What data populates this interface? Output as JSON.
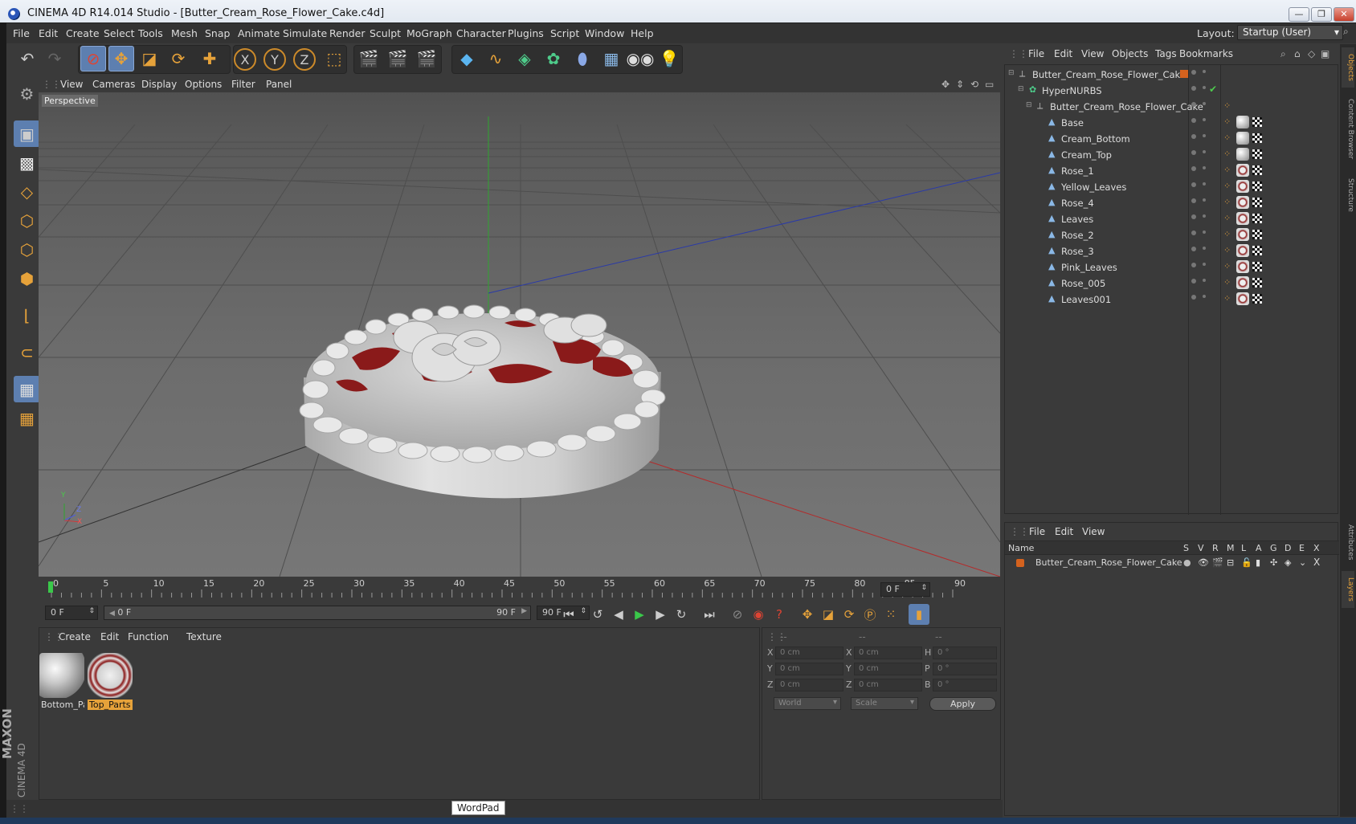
{
  "window": {
    "title": "CINEMA 4D R14.014 Studio - [Butter_Cream_Rose_Flower_Cake.c4d]",
    "minimize": "—",
    "restore": "❐",
    "close": "✕"
  },
  "menubar": {
    "items": [
      "File",
      "Edit",
      "Create",
      "Select",
      "Tools",
      "Mesh",
      "Snap",
      "Animate",
      "Simulate",
      "Render",
      "Sculpt",
      "MoGraph",
      "Character",
      "Plugins",
      "Script",
      "Window",
      "Help"
    ],
    "layout_label": "Layout:",
    "layout_value": "Startup (User)"
  },
  "toolbar": {
    "icons": [
      "undo-icon",
      "redo-icon",
      "live-selection-icon",
      "move-icon",
      "scale-icon",
      "rotate-icon",
      "add-icon",
      "x-axis-icon",
      "y-axis-icon",
      "z-axis-icon",
      "coordinate-system-icon",
      "render-view-icon",
      "render-picture-viewer-icon",
      "edit-render-settings-icon",
      "cube-primitive-icon",
      "spline-icon",
      "nurbs-icon",
      "array-icon",
      "deformer-icon",
      "floor-icon",
      "camera-icon",
      "light-icon"
    ],
    "axis_x": "X",
    "axis_y": "Y",
    "axis_z": "Z"
  },
  "viewport": {
    "menu": [
      "View",
      "Cameras",
      "Display",
      "Options",
      "Filter",
      "Panel"
    ],
    "camera_label": "Perspective",
    "axis_y": "Y",
    "axis_z": "Z",
    "axis_x": "X"
  },
  "timeline": {
    "ticks": [
      "0",
      "5",
      "10",
      "15",
      "20",
      "25",
      "30",
      "35",
      "40",
      "45",
      "50",
      "55",
      "60",
      "65",
      "70",
      "75",
      "80",
      "85",
      "90"
    ],
    "current_frame": "0 F",
    "start_frame": "0 F",
    "range_start": "0 F",
    "range_end": "90 F",
    "end_frame": "90 F",
    "max_frame": "0 F"
  },
  "materials": {
    "menu": [
      "Create",
      "Edit",
      "Function",
      "Texture"
    ],
    "items": [
      {
        "name": "Bottom_Pa",
        "selected": false
      },
      {
        "name": "Top_Parts",
        "selected": true
      }
    ]
  },
  "coordinates": {
    "headers": [
      "--",
      "--",
      "--"
    ],
    "rows": [
      {
        "l1": "X",
        "v1": "0 cm",
        "l2": "X",
        "v2": "0 cm",
        "l3": "H",
        "v3": "0 °"
      },
      {
        "l1": "Y",
        "v1": "0 cm",
        "l2": "Y",
        "v2": "0 cm",
        "l3": "P",
        "v3": "0 °"
      },
      {
        "l1": "Z",
        "v1": "0 cm",
        "l2": "Z",
        "v2": "0 cm",
        "l3": "B",
        "v3": "0 °"
      }
    ],
    "space": "World",
    "mode": "Scale",
    "apply": "Apply"
  },
  "object_manager": {
    "menu": [
      "File",
      "Edit",
      "View",
      "Objects",
      "Tags",
      "Bookmarks"
    ],
    "objects": [
      {
        "name": "Butter_Cream_Rose_Flower_Cake",
        "level": 0,
        "type": "null"
      },
      {
        "name": "HyperNURBS",
        "level": 1,
        "type": "hypernurbs"
      },
      {
        "name": "Butter_Cream_Rose_Flower_Cake",
        "level": 2,
        "type": "null"
      },
      {
        "name": "Base",
        "level": 3,
        "type": "poly",
        "mat": "white"
      },
      {
        "name": "Cream_Bottom",
        "level": 3,
        "type": "poly",
        "mat": "white"
      },
      {
        "name": "Cream_Top",
        "level": 3,
        "type": "poly",
        "mat": "white"
      },
      {
        "name": "Rose_1",
        "level": 3,
        "type": "poly",
        "mat": "red"
      },
      {
        "name": "Yellow_Leaves",
        "level": 3,
        "type": "poly",
        "mat": "red"
      },
      {
        "name": "Rose_4",
        "level": 3,
        "type": "poly",
        "mat": "red"
      },
      {
        "name": "Leaves",
        "level": 3,
        "type": "poly",
        "mat": "red"
      },
      {
        "name": "Rose_2",
        "level": 3,
        "type": "poly",
        "mat": "red"
      },
      {
        "name": "Rose_3",
        "level": 3,
        "type": "poly",
        "mat": "red"
      },
      {
        "name": "Pink_Leaves",
        "level": 3,
        "type": "poly",
        "mat": "red"
      },
      {
        "name": "Rose_005",
        "level": 3,
        "type": "poly",
        "mat": "red"
      },
      {
        "name": "Leaves001",
        "level": 3,
        "type": "poly",
        "mat": "red"
      }
    ]
  },
  "layer_manager": {
    "menu": [
      "File",
      "Edit",
      "View"
    ],
    "columns": [
      "Name",
      "S",
      "V",
      "R",
      "M",
      "L",
      "A",
      "G",
      "D",
      "E",
      "X"
    ],
    "layers": [
      {
        "name": "Butter_Cream_Rose_Flower_Cake",
        "color": "#d4621e"
      }
    ]
  },
  "side_tabs": [
    "Objects",
    "Content Browser",
    "Structure",
    "Attributes",
    "Layers"
  ],
  "branding": {
    "line1": "MAXON",
    "line2": "CINEMA 4D"
  },
  "status": {
    "tooltip": "WordPad"
  },
  "colors": {
    "accent": "#e6a23a",
    "selection": "#5d7fb0",
    "layer": "#d4621e",
    "rose": "#8a1a1a"
  }
}
